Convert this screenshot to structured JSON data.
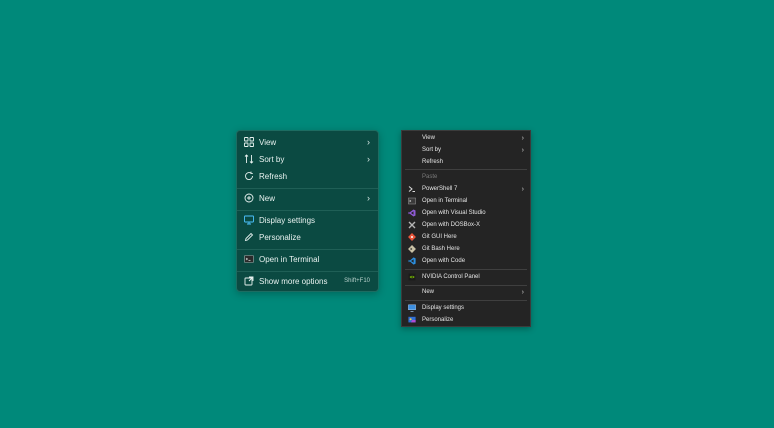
{
  "modern_menu": {
    "items": [
      {
        "label": "View",
        "icon": "grid-icon"
      },
      {
        "label": "Sort by",
        "icon": "sort-icon"
      },
      {
        "label": "Refresh",
        "icon": "refresh-icon"
      },
      {
        "label": "New",
        "icon": "plus-circle-icon"
      },
      {
        "label": "Display settings",
        "icon": "monitor-icon"
      },
      {
        "label": "Personalize",
        "icon": "pen-icon"
      },
      {
        "label": "Open in Terminal",
        "icon": "terminal-icon"
      },
      {
        "label": "Show more options",
        "icon": "external-link-icon",
        "shortcut": "Shift+F10"
      }
    ]
  },
  "classic_menu": {
    "items": [
      {
        "label": "View"
      },
      {
        "label": "Sort by"
      },
      {
        "label": "Refresh"
      },
      {
        "label": "Paste",
        "disabled": true
      },
      {
        "label": "PowerShell 7",
        "icon": "powershell-icon"
      },
      {
        "label": "Open in Terminal",
        "icon": "terminal-icon"
      },
      {
        "label": "Open with Visual Studio",
        "icon": "visual-studio-icon"
      },
      {
        "label": "Open with DOSBox-X",
        "icon": "dosbox-icon"
      },
      {
        "label": "Git GUI Here",
        "icon": "git-gui-icon"
      },
      {
        "label": "Git Bash Here",
        "icon": "git-bash-icon"
      },
      {
        "label": "Open with Code",
        "icon": "vscode-icon"
      },
      {
        "label": "NVIDIA Control Panel",
        "icon": "nvidia-icon"
      },
      {
        "label": "New"
      },
      {
        "label": "Display settings",
        "icon": "monitor-icon"
      },
      {
        "label": "Personalize",
        "icon": "personalize-icon"
      }
    ]
  },
  "colors": {
    "desktop_background": "#00897a",
    "modern_menu_background": "#0b4a42",
    "classic_menu_background": "#242424"
  }
}
